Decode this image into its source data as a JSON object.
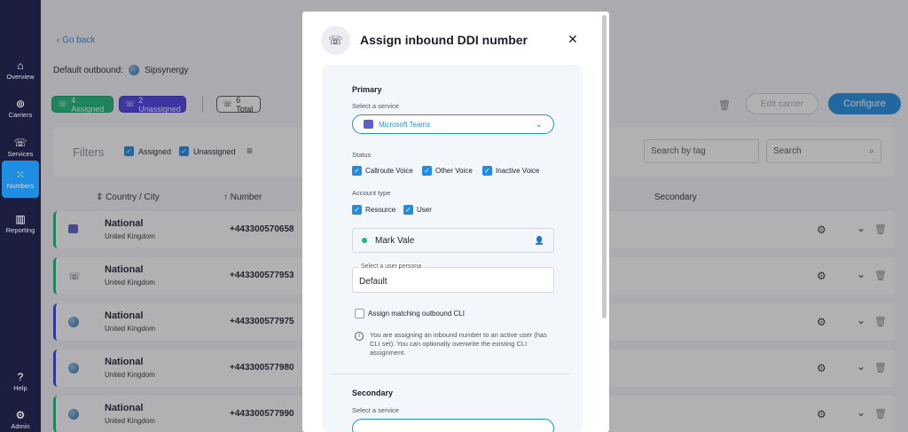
{
  "sidebar": {
    "items": [
      {
        "label": "Overview",
        "icon": "home-icon",
        "glyph": "⌂"
      },
      {
        "label": "Carriers",
        "icon": "antenna-icon",
        "glyph": "📡"
      },
      {
        "label": "Services",
        "icon": "phone-icon",
        "glyph": "☏"
      },
      {
        "label": "Numbers",
        "icon": "dialpad-icon",
        "glyph": "⁙"
      },
      {
        "label": "Reporting",
        "icon": "chart-icon",
        "glyph": "▥"
      }
    ],
    "bottom": [
      {
        "label": "Help",
        "icon": "help-icon",
        "glyph": "?"
      },
      {
        "label": "Admin",
        "icon": "admin-icon",
        "glyph": "⚙"
      }
    ]
  },
  "page": {
    "back_label": "Go back",
    "default_outbound_label": "Default outbound:",
    "default_outbound_value": "Sipsynergy",
    "chips": {
      "assigned": "4 Assigned",
      "unassigned": "2 Unassigned",
      "total": "6 Total"
    },
    "edit_carrier_label": "Edit carrier",
    "configure_label": "Configure"
  },
  "filters": {
    "label": "Filters",
    "assigned": "Assigned",
    "unassigned": "Unassigned",
    "tag_placeholder": "Search by tag",
    "search_placeholder": "Search"
  },
  "table": {
    "headers": {
      "country": "Country / City",
      "number": "Number",
      "secondary": "Secondary"
    },
    "rows": [
      {
        "name": "National",
        "country": "United Kingdom",
        "number": "+443300570658"
      },
      {
        "name": "National",
        "country": "United Kingdom",
        "number": "+443300577953"
      },
      {
        "name": "National",
        "country": "United Kingdom",
        "number": "+443300577975"
      },
      {
        "name": "National",
        "country": "United Kingdom",
        "number": "+443300577980"
      },
      {
        "name": "National",
        "country": "United Kingdom",
        "number": "+443300577990"
      }
    ]
  },
  "modal": {
    "title": "Assign inbound DDI number",
    "primary": {
      "heading": "Primary",
      "select_label": "Select a service",
      "service": "Microsoft Teams",
      "status_label": "Status",
      "status_options": [
        "Callroute Voice",
        "Other Voice",
        "Inactive Voice"
      ],
      "account_type_label": "Account type",
      "account_type_options": [
        "Resource",
        "User"
      ],
      "user": "Mark Vale",
      "persona_label": "Select a user persona",
      "persona_value": "Default",
      "assign_cli_label": "Assign matching outbound CLI",
      "info_text": "You are assigning an inbound number to an active user (has CLI set). You can optionally overwrite the existing CLI assignment."
    },
    "secondary": {
      "heading": "Secondary",
      "select_label": "Select a service"
    }
  },
  "colors": {
    "sidebar": "#1b1e3f",
    "accent": "#1f8ee2",
    "assigned": "#19b979",
    "unassigned": "#4b3fe0"
  }
}
